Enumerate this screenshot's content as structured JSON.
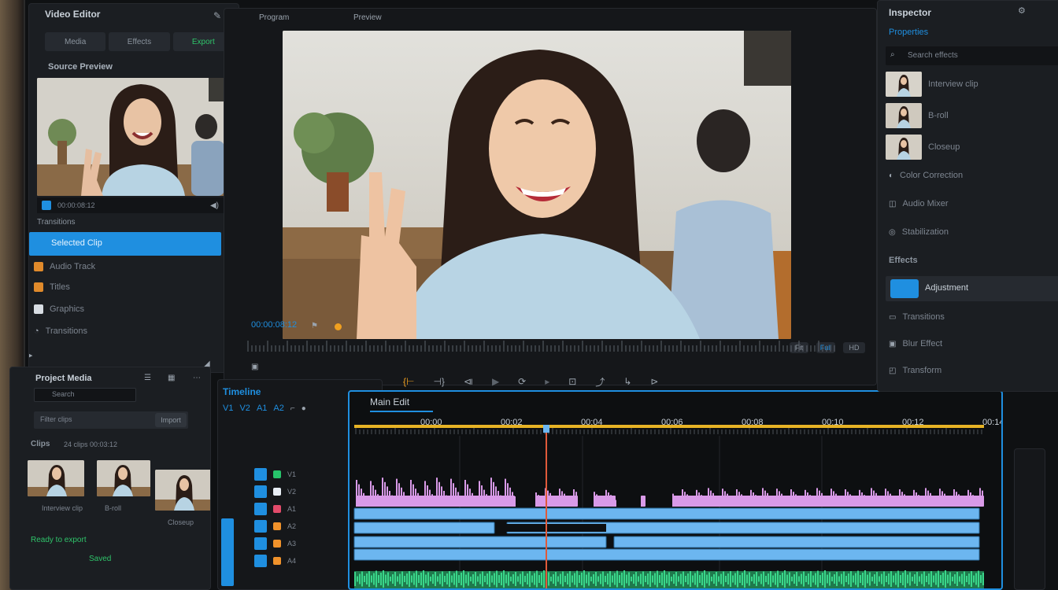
{
  "source_panel": {
    "title": "Video Editor",
    "tabs": [
      "Media",
      "Effects",
      "Export"
    ],
    "subtitle": "Source Preview",
    "items": [
      {
        "label": "Selected Clip"
      },
      {
        "label": "Audio Track"
      },
      {
        "label": "Titles"
      },
      {
        "label": "Graphics"
      },
      {
        "label": "Transitions"
      }
    ]
  },
  "project_panel": {
    "title": "Project Media",
    "search_placeholder": "Search",
    "filter_label": "Filter clips",
    "filter_button": "Import",
    "subtitle": "Clips",
    "meta": "24 clips 00:03:12",
    "footer": "Ready to export",
    "footer_accent": "Saved"
  },
  "program_monitor": {
    "title": "Program",
    "tab": "Preview",
    "timecode": "00:00:08:12",
    "right_labels": [
      "Fit",
      "Full",
      "HD"
    ]
  },
  "transport": {
    "icons": [
      "mark-in-icon",
      "mark-out-icon",
      "step-back-icon",
      "play-icon",
      "loop-icon",
      "step-forward-icon",
      "insert-icon",
      "overwrite-icon",
      "lift-icon",
      "extract-icon"
    ]
  },
  "timeline": {
    "title": "Timeline",
    "sequence": "Main Edit",
    "tools": [
      "V1",
      "V2",
      "A1",
      "A2"
    ],
    "ruler_labels": [
      "00:00",
      "00:02",
      "00:04",
      "00:06",
      "00:08",
      "00:10",
      "00:12",
      "00:14"
    ],
    "tracks": [
      {
        "name": "V1",
        "color": "#1f8fe0"
      },
      {
        "name": "V2",
        "color": "#1f8fe0"
      },
      {
        "name": "A1",
        "color": "#1f8fe0"
      },
      {
        "name": "A2",
        "color": "#1f8fe0"
      },
      {
        "name": "A3",
        "color": "#1f8fe0"
      },
      {
        "name": "A4",
        "color": "#1f8fe0"
      }
    ],
    "track_dots": [
      "#27c46b",
      "#e8eef5",
      "#e24b6a",
      "#f0922b",
      "#f0922b",
      "#f0922b"
    ]
  },
  "right_panel": {
    "title": "Inspector",
    "tab": "Properties",
    "search": "Search effects",
    "media_items": [
      {
        "label": "Interview clip"
      },
      {
        "label": "B-roll"
      },
      {
        "label": "Closeup"
      }
    ],
    "list_items": [
      {
        "label": "Color Correction"
      },
      {
        "label": "Audio Mixer"
      },
      {
        "label": "Stabilization"
      }
    ],
    "section": "Effects",
    "effect_items": [
      {
        "label": "Adjustment",
        "selected": true
      },
      {
        "label": "Transitions"
      },
      {
        "label": "Blur Effect"
      },
      {
        "label": "Transform"
      }
    ]
  },
  "colors": {
    "accent": "#1f8fe0",
    "playhead": "#e05a3a",
    "work_area": "#e6b325",
    "video_clip": "#6cb6f0",
    "audio_purple": "#d99ae8",
    "audio_green": "#3ad68a"
  }
}
